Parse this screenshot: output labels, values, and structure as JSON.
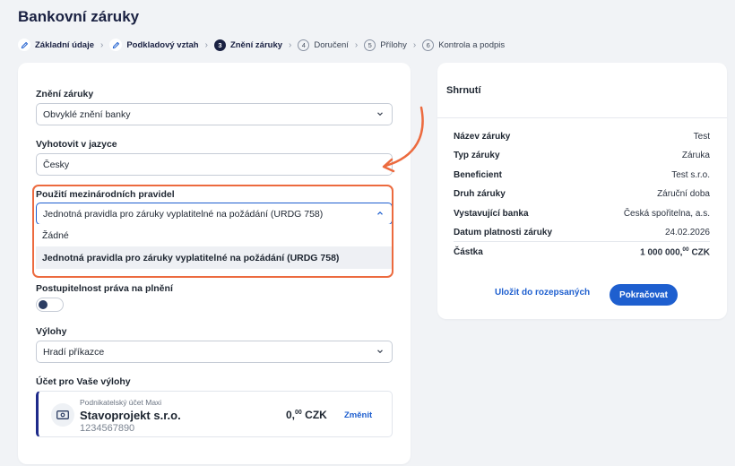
{
  "header": {
    "title": "Bankovní záruky"
  },
  "stepper": {
    "steps": [
      {
        "label": "Základní údaje",
        "state": "done",
        "icon": "pencil-icon"
      },
      {
        "label": "Podkladový vztah",
        "state": "done",
        "icon": "pencil-icon"
      },
      {
        "label": "Znění záruky",
        "state": "active",
        "number": "3"
      },
      {
        "label": "Doručení",
        "state": "future",
        "number": "4"
      },
      {
        "label": "Přílohy",
        "state": "future",
        "number": "5"
      },
      {
        "label": "Kontrola a podpis",
        "state": "future",
        "number": "6"
      }
    ]
  },
  "form": {
    "wording": {
      "label": "Znění záruky",
      "value": "Obvyklé znění banky"
    },
    "language": {
      "label": "Vyhotovit v jazyce",
      "value": "Česky"
    },
    "rules": {
      "label": "Použití mezinárodních pravidel",
      "value": "Jednotná pravidla pro záruky vyplatitelné na požádání (URDG 758)",
      "options": [
        "Žádné",
        "Jednotná pravidla pro záruky vyplatitelné na požádání (URDG 758)"
      ]
    },
    "assignability": {
      "label": "Postupitelnost práva na plnění",
      "enabled": false
    },
    "fees": {
      "label": "Výlohy",
      "value": "Hradí příkazce"
    },
    "account": {
      "label": "Účet pro Vaše výlohy",
      "type": "Podnikatelský účet Maxi",
      "name": "Stavoprojekt s.r.o.",
      "number": "1234567890",
      "amount_main": "0,",
      "amount_dec": "00",
      "currency": "CZK",
      "change_label": "Změnit"
    }
  },
  "summary": {
    "title": "Shrnutí",
    "rows": [
      {
        "key": "Název záruky",
        "value": "Test"
      },
      {
        "key": "Typ záruky",
        "value": "Záruka"
      },
      {
        "key": "Beneficient",
        "value": "Test s.r.o."
      },
      {
        "key": "Druh záruky",
        "value": "Záruční doba"
      },
      {
        "key": "Vystavující banka",
        "value": "Česká spořitelna, a.s."
      },
      {
        "key": "Datum platnosti záruky",
        "value": "24.02.2026"
      }
    ],
    "total": {
      "key": "Částka",
      "value_main": "1 000 000,",
      "value_dec": "00",
      "currency": "CZK"
    },
    "save_label": "Uložit do rozepsaných",
    "continue_label": "Pokračovat"
  },
  "colors": {
    "accent": "#1e5fcf",
    "highlight": "#ec6a3e",
    "title": "#1a2142"
  }
}
